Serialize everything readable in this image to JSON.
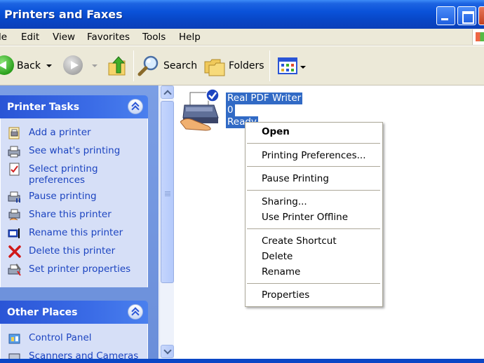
{
  "window": {
    "title": "Printers and Faxes"
  },
  "menu": [
    "le",
    "Edit",
    "View",
    "Favorites",
    "Tools",
    "Help"
  ],
  "toolbar": {
    "back_label": "Back",
    "search_label": "Search",
    "folders_label": "Folders"
  },
  "taskpane": {
    "printer_tasks": {
      "title": "Printer Tasks",
      "items": [
        {
          "label": "Add a printer",
          "icon": "add-printer-icon"
        },
        {
          "label": "See what's printing",
          "icon": "printer-queue-icon"
        },
        {
          "label": "Select printing",
          "label2": "preferences",
          "icon": "preferences-icon"
        },
        {
          "label": "Pause printing",
          "icon": "pause-printer-icon"
        },
        {
          "label": "Share this printer",
          "icon": "share-printer-icon"
        },
        {
          "label": "Rename this printer",
          "icon": "rename-icon"
        },
        {
          "label": "Delete this printer",
          "icon": "delete-x-icon"
        },
        {
          "label": "Set printer properties",
          "icon": "printer-properties-icon"
        }
      ]
    },
    "other_places": {
      "title": "Other Places",
      "items": [
        {
          "label": "Control Panel",
          "icon": "control-panel-icon"
        },
        {
          "label": "Scanners and Cameras",
          "icon": "scanner-icon"
        }
      ]
    }
  },
  "printer": {
    "name": "Real PDF Writer",
    "docs": "0",
    "status": "Ready"
  },
  "context_menu": {
    "items": [
      "Open",
      "Printing Preferences...",
      "Pause Printing",
      "Sharing...",
      "Use Printer Offline",
      "Create Shortcut",
      "Delete",
      "Rename",
      "Properties"
    ]
  },
  "colors": {
    "titlebar": "#0a52d9",
    "selection": "#316ac5",
    "link": "#1c44c0",
    "taskpane_body": "#d6dff7"
  }
}
